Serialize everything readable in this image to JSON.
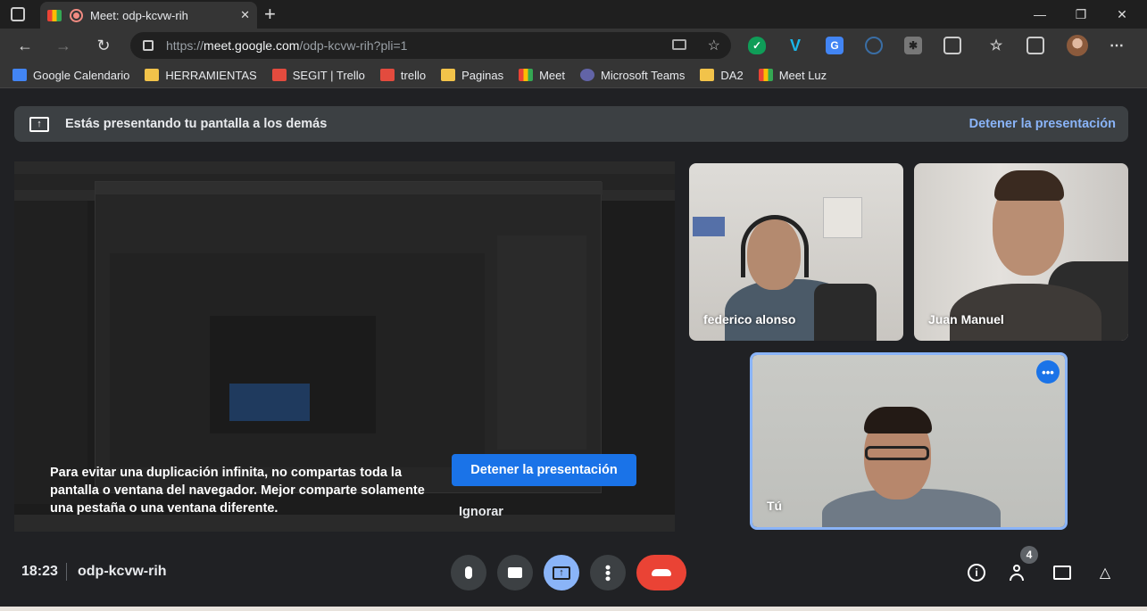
{
  "browser": {
    "tab_title": "Meet: odp-kcvw-rih",
    "url_base": "https://",
    "url_host": "meet.google.com",
    "url_path": "/odp-kcvw-rih?pli=1",
    "new_tab_symbol": "+",
    "minimize_symbol": "—",
    "maximize_symbol": "❐",
    "close_symbol": "✕"
  },
  "bookmarks": [
    {
      "label": "Google Calendario",
      "icon": "calendar-icon",
      "color": "#4285f4"
    },
    {
      "label": "HERRAMIENTAS",
      "icon": "folder-icon",
      "color": "#f2c34a"
    },
    {
      "label": "SEGIT | Trello",
      "icon": "trello-icon",
      "color": "#e34b3e"
    },
    {
      "label": "trello",
      "icon": "trello-icon",
      "color": "#e34b3e"
    },
    {
      "label": "Paginas",
      "icon": "folder-icon",
      "color": "#f2c34a"
    },
    {
      "label": "Meet",
      "icon": "meet-icon",
      "color": "#34a853"
    },
    {
      "label": "Microsoft Teams",
      "icon": "teams-icon",
      "color": "#6264a7"
    },
    {
      "label": "DA2",
      "icon": "folder-icon",
      "color": "#f2c34a"
    },
    {
      "label": "Meet Luz",
      "icon": "meet-icon",
      "color": "#34a853"
    }
  ],
  "banner": {
    "message": "Estás presentando tu pantalla a los demás",
    "stop_label": "Detener la presentación"
  },
  "presentation": {
    "warning": "Para evitar una duplicación infinita, no compartas toda la pantalla o ventana del navegador. Mejor comparte solamente una pestaña o una ventana diferente.",
    "stop_button": "Detener la presentación",
    "ignore_button": "Ignorar"
  },
  "participants": [
    {
      "name": "federico alonso"
    },
    {
      "name": "Juan Manuel"
    },
    {
      "name": "Tú"
    }
  ],
  "you_tile_more": "•••",
  "meeting": {
    "time": "18:23",
    "code": "odp-kcvw-rih",
    "participant_count": "4"
  },
  "colors": {
    "accent": "#8ab4f8",
    "primary_button": "#1a73e8",
    "leave": "#ea4335",
    "surface": "#202124"
  }
}
